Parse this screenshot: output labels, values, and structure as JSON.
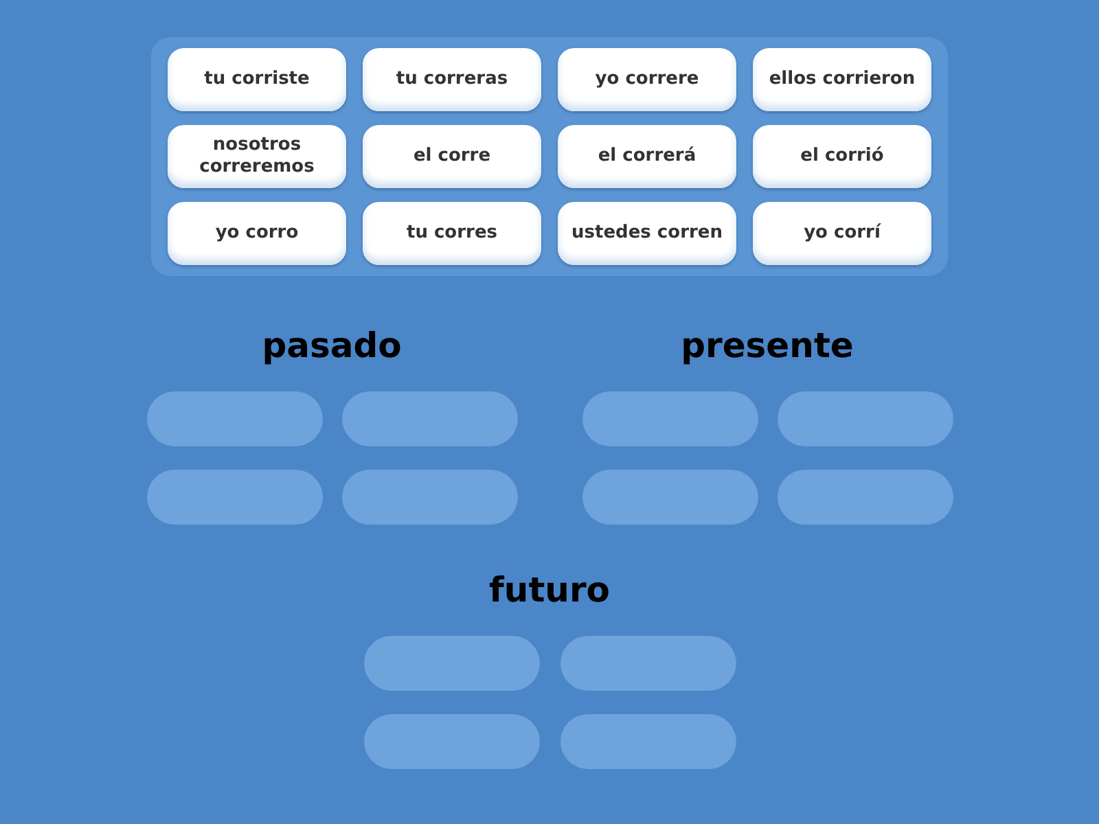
{
  "tiles": [
    {
      "label": "tu corriste"
    },
    {
      "label": "tu correras"
    },
    {
      "label": "yo correre"
    },
    {
      "label": "ellos corrieron"
    },
    {
      "label": "nosotros correremos"
    },
    {
      "label": "el corre"
    },
    {
      "label": "el correrá"
    },
    {
      "label": "el corrió"
    },
    {
      "label": "yo corro"
    },
    {
      "label": "tu corres"
    },
    {
      "label": "ustedes corren"
    },
    {
      "label": "yo corrí"
    }
  ],
  "groups": [
    {
      "title": "pasado"
    },
    {
      "title": "presente"
    },
    {
      "title": "futuro"
    }
  ]
}
